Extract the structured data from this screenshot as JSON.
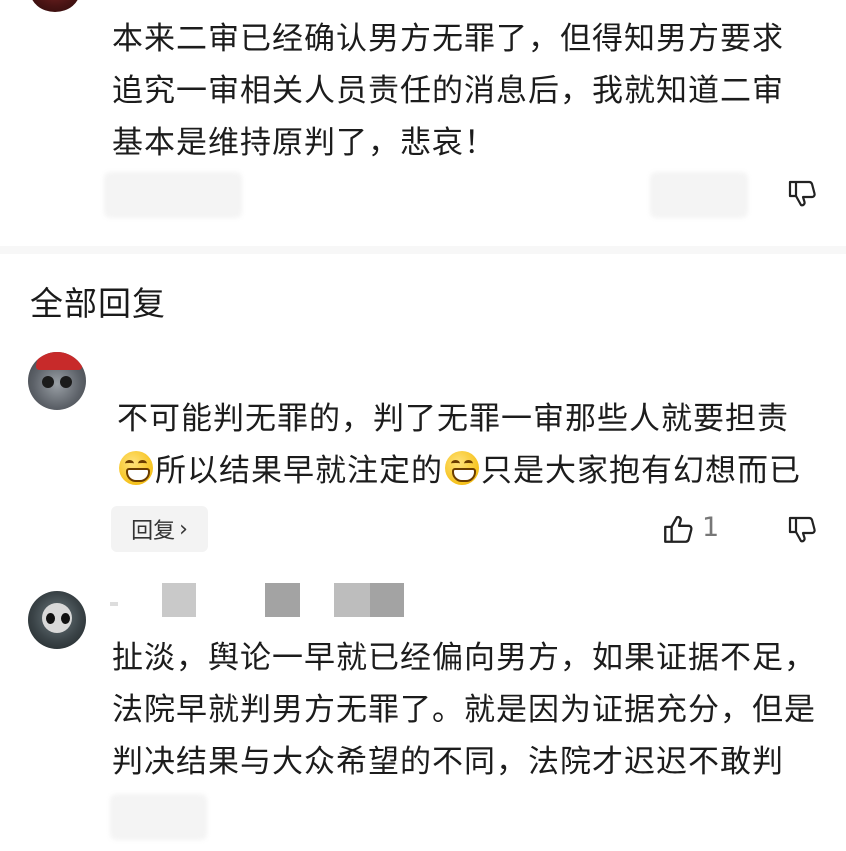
{
  "parent_comment": {
    "lines": [
      "本来二审已经确认男方无罪了，但得知男方要求",
      "追究一审相关人员责任的消息后，我就知道二审",
      "基本是维持原判了，悲哀！"
    ]
  },
  "section": {
    "title": "全部回复"
  },
  "replies": [
    {
      "line1": "不可能判无罪的，判了无罪一审那些人就要担责",
      "line2_part1": "所以结果早就注定的",
      "line2_part2": "只是大家抱有幻想而已",
      "reply_label": "回复",
      "reply_chevron": "›",
      "like_count": "1"
    },
    {
      "lines": [
        "扯淡，舆论一早就已经偏向男方，如果证据不足，",
        "法院早就判男方无罪了。就是因为证据充分，但是",
        "判决结果与大众希望的不同，法院才迟迟不敢判"
      ]
    }
  ],
  "icons": {
    "dislike": "thumbs-down-icon",
    "like": "thumbs-up-icon",
    "emoji": "grinning-emoji-icon"
  },
  "colors": {
    "text": "#1c1c1c",
    "muted": "#777777",
    "reply_button_bg": "#f3f3f3",
    "divider": "#f7f7f7"
  }
}
